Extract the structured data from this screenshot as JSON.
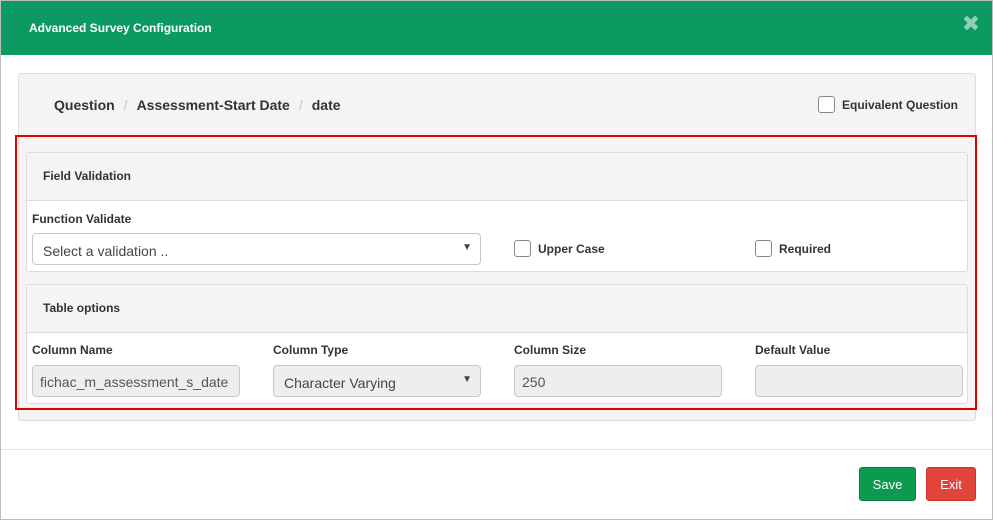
{
  "modal": {
    "title": "Advanced Survey Configuration",
    "close_glyph": "✖"
  },
  "breadcrumb": {
    "items": [
      "Question",
      "Assessment-Start Date",
      "date"
    ],
    "separator": "/"
  },
  "equivalent_question": {
    "label": "Equivalent Question",
    "checked": false
  },
  "field_validation": {
    "heading": "Field Validation",
    "function_label": "Function Validate",
    "function_placeholder": "Select a validation ..",
    "upper_case_label": "Upper Case",
    "required_label": "Required"
  },
  "table_options": {
    "heading": "Table options",
    "column_name_label": "Column Name",
    "column_name_value": "fichac_m_assessment_s_date",
    "column_type_label": "Column Type",
    "column_type_value": "Character Varying",
    "column_size_label": "Column Size",
    "column_size_value": "250",
    "default_value_label": "Default Value",
    "default_value_value": ""
  },
  "footer": {
    "save_label": "Save",
    "exit_label": "Exit"
  },
  "colors": {
    "header": "#0b9a62",
    "save": "#0b9a50",
    "exit": "#e0443a",
    "highlight": "#e00000"
  }
}
